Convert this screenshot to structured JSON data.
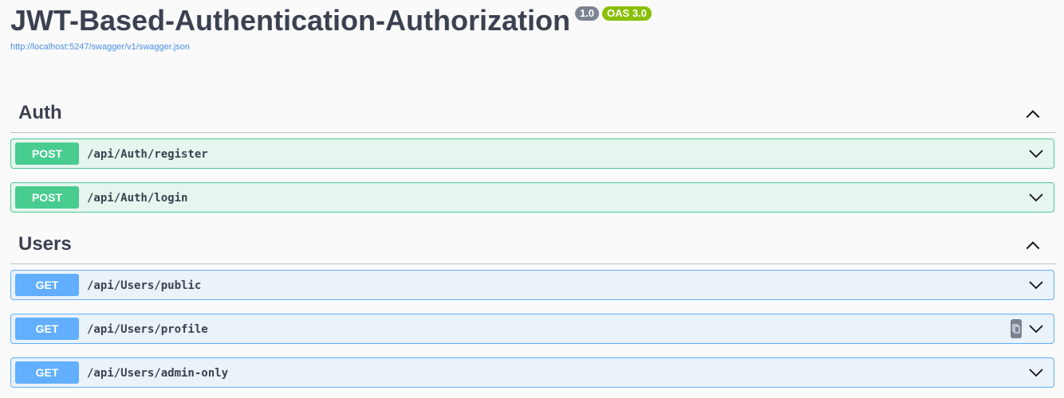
{
  "info": {
    "title": "JWT-Based-Authentication-Authorization",
    "version_badge": "1.0",
    "oas_badge": "OAS 3.0",
    "spec_url": "http://localhost:5247/swagger/v1/swagger.json"
  },
  "colors": {
    "post": "#49cc90",
    "get": "#61affe",
    "title": "#3b4151",
    "link": "#4990e2",
    "version_badge": "#7d8492",
    "oas_badge": "#89bf04"
  },
  "tags": [
    {
      "name": "Auth",
      "collapse_icon": "chevron-up-icon",
      "operations": [
        {
          "method": "POST",
          "path": "/api/Auth/register",
          "expand_icon": "chevron-down-icon"
        },
        {
          "method": "POST",
          "path": "/api/Auth/login",
          "expand_icon": "chevron-down-icon"
        }
      ]
    },
    {
      "name": "Users",
      "collapse_icon": "chevron-up-icon",
      "operations": [
        {
          "method": "GET",
          "path": "/api/Users/public",
          "expand_icon": "chevron-down-icon"
        },
        {
          "method": "GET",
          "path": "/api/Users/profile",
          "expand_icon": "chevron-down-icon",
          "copy_icon": "copy-to-clipboard-icon"
        },
        {
          "method": "GET",
          "path": "/api/Users/admin-only",
          "expand_icon": "chevron-down-icon"
        }
      ]
    }
  ]
}
